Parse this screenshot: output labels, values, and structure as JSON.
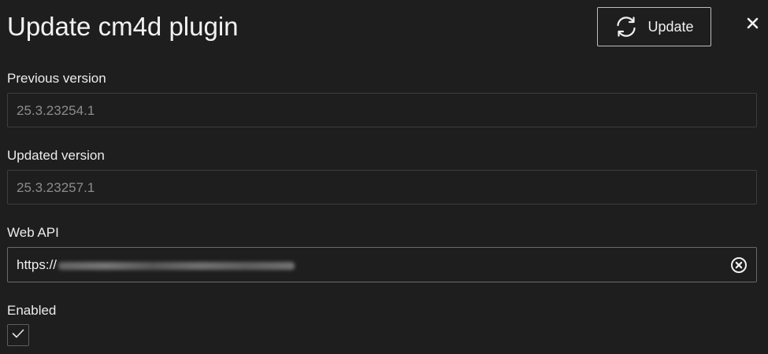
{
  "dialog": {
    "title": "Update cm4d plugin",
    "update_button_label": "Update",
    "update_icon": "refresh-icon",
    "close_icon": "close-icon"
  },
  "fields": {
    "previous_version": {
      "label": "Previous version",
      "value": "25.3.23254.1"
    },
    "updated_version": {
      "label": "Updated version",
      "value": "25.3.23257.1"
    },
    "web_api": {
      "label": "Web API",
      "value_prefix": "https://",
      "clear_icon": "clear-circle-icon"
    },
    "enabled": {
      "label": "Enabled",
      "checked": true,
      "check_icon": "checkmark-icon"
    }
  },
  "colors": {
    "background": "#1e1e1e",
    "text": "#ececec",
    "muted_text": "#8c8c8c",
    "border": "#3d3d3d"
  }
}
